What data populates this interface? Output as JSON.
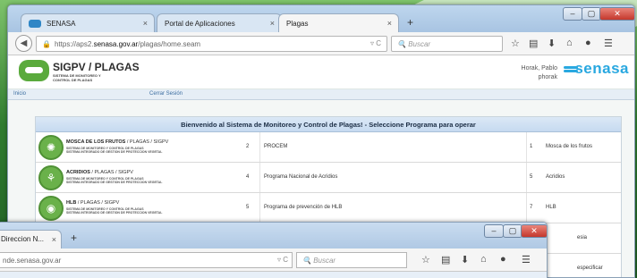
{
  "browser": {
    "tabs": [
      {
        "label": "SENASA"
      },
      {
        "label": "Portal de Aplicaciones"
      },
      {
        "label": "Plagas"
      }
    ],
    "url_prefix": "https://aps2.",
    "url_domain": "senasa.gov.ar",
    "url_path": "/plagas/home.seam",
    "search_placeholder": "Buscar"
  },
  "app": {
    "title": "SIGPV / PLAGAS",
    "subtitle_lines": [
      "SISTEMA DE MONITOREO Y",
      "CONTROL DE PLAGAS"
    ],
    "user_name": "Horak, Pablo",
    "user_login": "phorak",
    "brand": "senasa",
    "menu": {
      "home": "Inicio",
      "logout": "Cerrar Sesión"
    }
  },
  "panel": {
    "heading": "Bienvenido al Sistema de Monitoreo y Control de Plagas! - Seleccione Programa para operar",
    "rows": [
      {
        "name": "MOSCA DE LOS FRUTOS",
        "path": " / PLAGAS / SIGPV",
        "sub1": "SISTEMA DE MONITOREO Y CONTROL DE PLAGAS",
        "sub2": "SISTEMA INTEGRADO DE GESTION DE PROTECCION VEGETAL",
        "num1": "2",
        "program": "PROCEM",
        "num2": "1",
        "plague": "Mosca de los frutos",
        "icon": "fly-icon"
      },
      {
        "name": "ACRIDIOS",
        "path": " / PLAGAS / SIGPV",
        "sub1": "SISTEMA DE MONITOREO Y CONTROL DE PLAGAS",
        "sub2": "SISTEMA INTEGRADO DE GESTION DE PROTECCION VEGETAL",
        "num1": "4",
        "program": "Programa Nacional de Acridios",
        "num2": "5",
        "plague": "Acridios",
        "icon": "locust-icon"
      },
      {
        "name": "HLB",
        "path": " / PLAGAS / SIGPV",
        "sub1": "SISTEMA DE MONITOREO Y CONTROL DE PLAGAS",
        "sub2": "SISTEMA INTEGRADO DE GESTION DE PROTECCION VEGETAL",
        "num1": "5",
        "program": "Programa de prevención de HLB",
        "num2": "7",
        "plague": "HLB",
        "icon": "citrus-icon"
      },
      {
        "name": "",
        "path": "",
        "sub1": "",
        "sub2": "",
        "num1": "",
        "program": "",
        "num2": "",
        "plague": "esia",
        "icon": "program-icon"
      },
      {
        "name": "",
        "path": "",
        "sub1": "",
        "sub2": "",
        "num1": "",
        "program": "",
        "num2": "",
        "plague": "especificar",
        "icon": "program-icon"
      }
    ]
  },
  "second_window": {
    "tab_label": "Direccion N...",
    "url_domain": "nde.senasa.gov.ar",
    "search_placeholder": "Buscar"
  }
}
